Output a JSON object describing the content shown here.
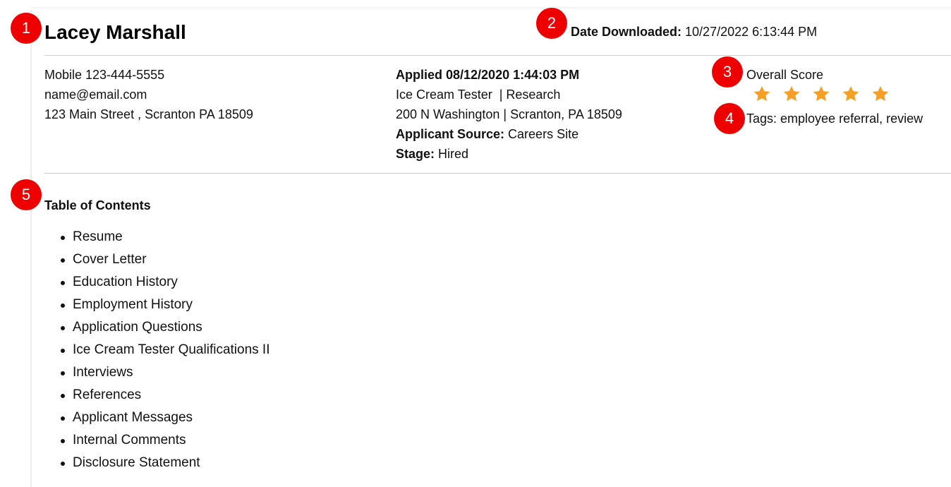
{
  "candidate": {
    "name": "Lacey Marshall"
  },
  "download": {
    "label": "Date Downloaded:",
    "value": "10/27/2022 6:13:44 PM"
  },
  "contact": {
    "phone": "Mobile 123-444-5555",
    "email": "name@email.com",
    "address": "123 Main Street , Scranton PA 18509"
  },
  "application": {
    "applied": "Applied 08/12/2020 1:44:03 PM",
    "position": "Ice Cream Tester  | Research",
    "location": "200 N Washington | Scranton, PA 18509",
    "source_label": "Applicant Source:",
    "source_value": "Careers Site",
    "stage_label": "Stage:",
    "stage_value": "Hired"
  },
  "score": {
    "label": "Overall Score",
    "rating": 5,
    "max": 5,
    "star_color": "#f5a024",
    "star_icon": "star-icon"
  },
  "tags": {
    "text": "Tags: employee referral, review"
  },
  "toc": {
    "title": "Table of Contents",
    "items": [
      "Resume",
      "Cover Letter",
      "Education History",
      "Employment History",
      "Application Questions",
      "Ice Cream Tester Qualifications II",
      "Interviews",
      "References",
      "Applicant Messages",
      "Internal Comments",
      "Disclosure Statement"
    ]
  },
  "markers": [
    "1",
    "2",
    "3",
    "4",
    "5"
  ],
  "colors": {
    "marker": "#ee0000",
    "divider": "#cfcfcf"
  }
}
